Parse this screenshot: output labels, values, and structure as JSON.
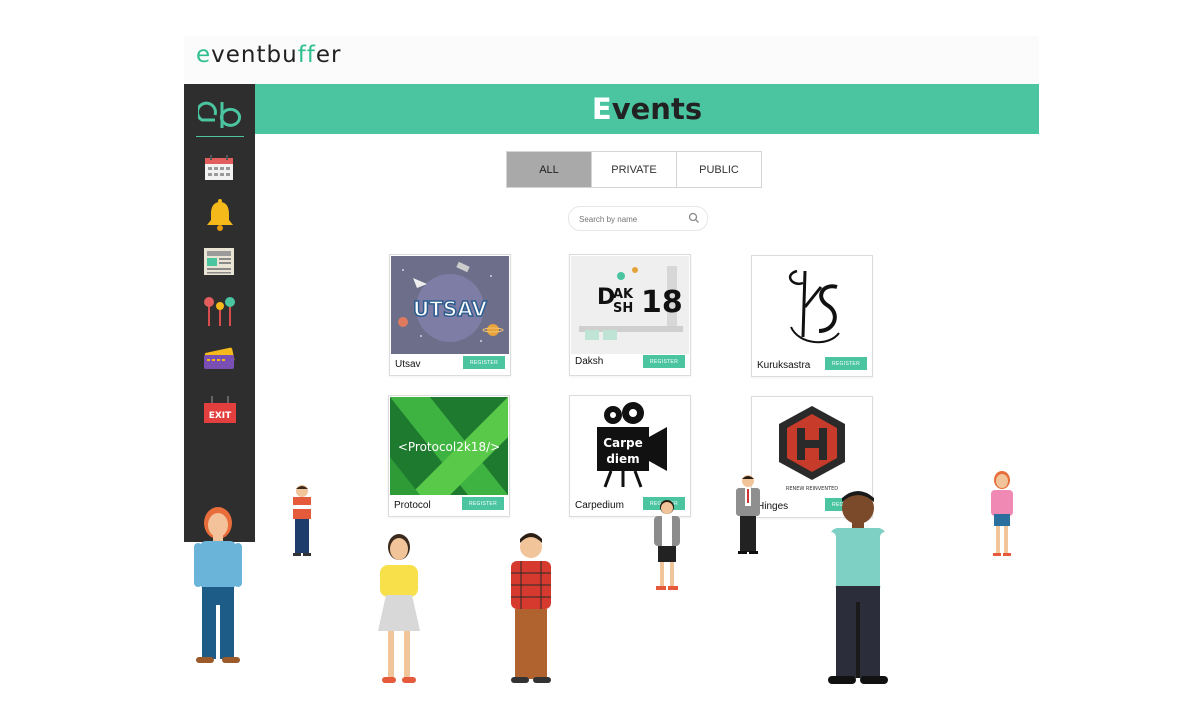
{
  "brand": {
    "prefix": "e",
    "middle": "ventbu",
    "highlight": "ff",
    "suffix": "er",
    "short": "eb"
  },
  "header": {
    "title_first": "E",
    "title_rest": "vents"
  },
  "tabs": [
    "ALL",
    "PRIVATE",
    "PUBLIC"
  ],
  "active_tab": "ALL",
  "search": {
    "placeholder": "Search by name"
  },
  "sidebar": {
    "items": [
      {
        "icon": "calendar-icon"
      },
      {
        "icon": "bell-icon"
      },
      {
        "icon": "newspaper-icon"
      },
      {
        "icon": "pins-icon"
      },
      {
        "icon": "tickets-icon"
      },
      {
        "icon": "exit-icon",
        "label": "EXIT"
      }
    ]
  },
  "events": [
    {
      "name": "Utsav",
      "register": "REGISTER",
      "poster_text": "UTSAV"
    },
    {
      "name": "Daksh",
      "register": "REGISTER",
      "poster_text": "DAKSH18"
    },
    {
      "name": "Kuruksastra",
      "register": "REGISTER",
      "poster_text": "KS"
    },
    {
      "name": "Protocol",
      "register": "REGISTER",
      "poster_text": "<Protocol2k18/>"
    },
    {
      "name": "Carpedium",
      "register": "REGISTER",
      "poster_text_1": "Carpe",
      "poster_text_2": "diem"
    },
    {
      "name": "Hinges",
      "register": "REGISTER",
      "poster_text": "RENEW REINVENTED"
    }
  ],
  "colors": {
    "accent": "#4bc5a0",
    "sidebar": "#2e2e2e",
    "active_tab": "#a9a9a9"
  }
}
